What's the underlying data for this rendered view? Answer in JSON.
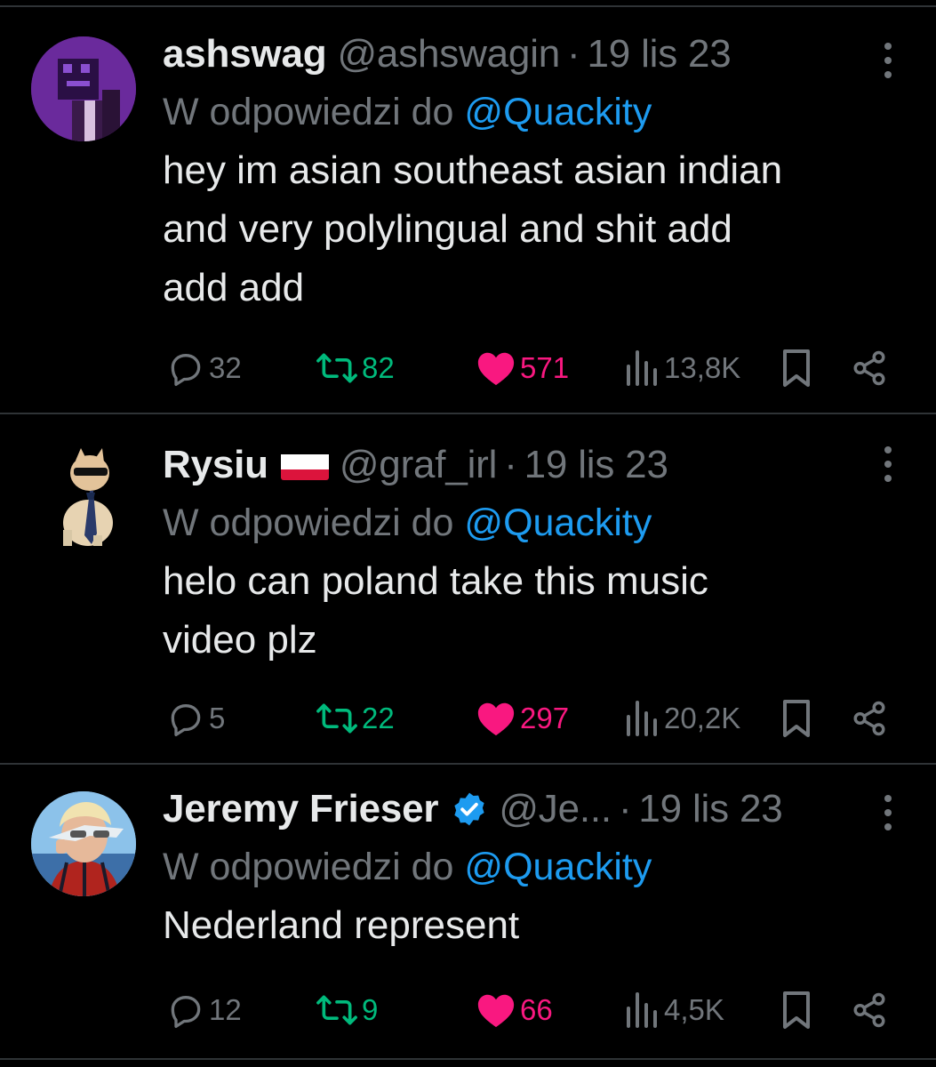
{
  "reply_prefix": "W odpowiedzi do",
  "tweets": [
    {
      "name": "ashswag",
      "handle": "@ashswagin",
      "separator": "·",
      "date": "19 lis 23",
      "reply_to": "@Quackity",
      "text_lines": [
        "hey im  asian southeast asian indian",
        "and very polylingual and shit add",
        "add add"
      ],
      "replies": "32",
      "retweets": "82",
      "likes": "571",
      "views": "13,8K"
    },
    {
      "name": "Rysiu",
      "has_flag": "poland-flag",
      "handle": "@graf_irl",
      "separator": "·",
      "date": "19 lis 23",
      "reply_to": "@Quackity",
      "text_lines": [
        "helo can poland take this music",
        "video plz"
      ],
      "replies": "5",
      "retweets": "22",
      "likes": "297",
      "views": "20,2K"
    },
    {
      "name": "Jeremy Frieser",
      "verified": "verified-badge-icon",
      "handle": "@Je...",
      "separator": "·",
      "date": "19 lis 23",
      "reply_to": "@Quackity",
      "text_lines": [
        "Nederland represent"
      ],
      "replies": "12",
      "retweets": "9",
      "likes": "66",
      "views": "4,5K"
    }
  ],
  "colors": {
    "background": "#000000",
    "text": "#e7e9ea",
    "muted": "#71767b",
    "mention": "#1d9bf0",
    "retweet": "#00ba7c",
    "like": "#f91880",
    "verified": "#1d9bf0"
  }
}
